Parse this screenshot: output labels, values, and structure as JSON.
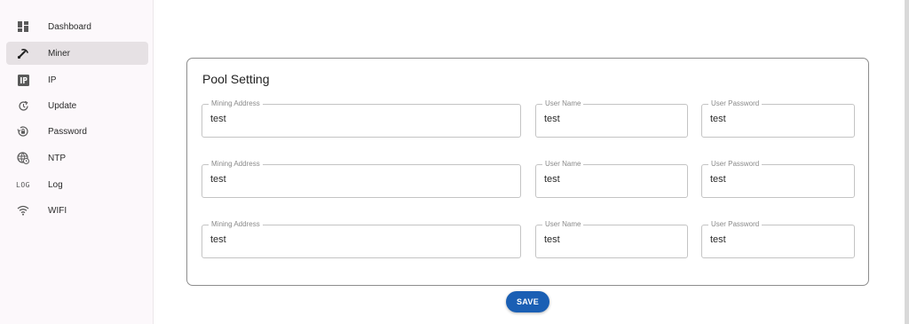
{
  "sidebar": {
    "items": [
      {
        "label": "Dashboard",
        "icon": "dashboard-icon",
        "active": false
      },
      {
        "label": "Miner",
        "icon": "pickaxe-icon",
        "active": true
      },
      {
        "label": "IP",
        "icon": "ip-icon",
        "active": false
      },
      {
        "label": "Update",
        "icon": "update-icon",
        "active": false
      },
      {
        "label": "Password",
        "icon": "lock-reset-icon",
        "active": false
      },
      {
        "label": "NTP",
        "icon": "globe-clock-icon",
        "active": false
      },
      {
        "label": "Log",
        "icon": "log-icon",
        "active": false,
        "glyph": "LOG"
      },
      {
        "label": "WIFI",
        "icon": "wifi-icon",
        "active": false
      }
    ]
  },
  "pool_setting": {
    "title": "Pool Setting",
    "pools": [
      {
        "address_label": "Mining Address",
        "address": "test",
        "user_label": "User Name",
        "user": "test",
        "password_label": "User Password",
        "password": "test"
      },
      {
        "address_label": "Mining Address",
        "address": "test",
        "user_label": "User Name",
        "user": "test",
        "password_label": "User Password",
        "password": "test"
      },
      {
        "address_label": "Mining Address",
        "address": "test",
        "user_label": "User Name",
        "user": "test",
        "password_label": "User Password",
        "password": "test"
      }
    ]
  },
  "actions": {
    "save_label": "SAVE"
  },
  "colors": {
    "accent": "#1a5fb4",
    "sidebar_bg": "#fcf8fb",
    "active_item_bg": "#e6e1e4"
  }
}
